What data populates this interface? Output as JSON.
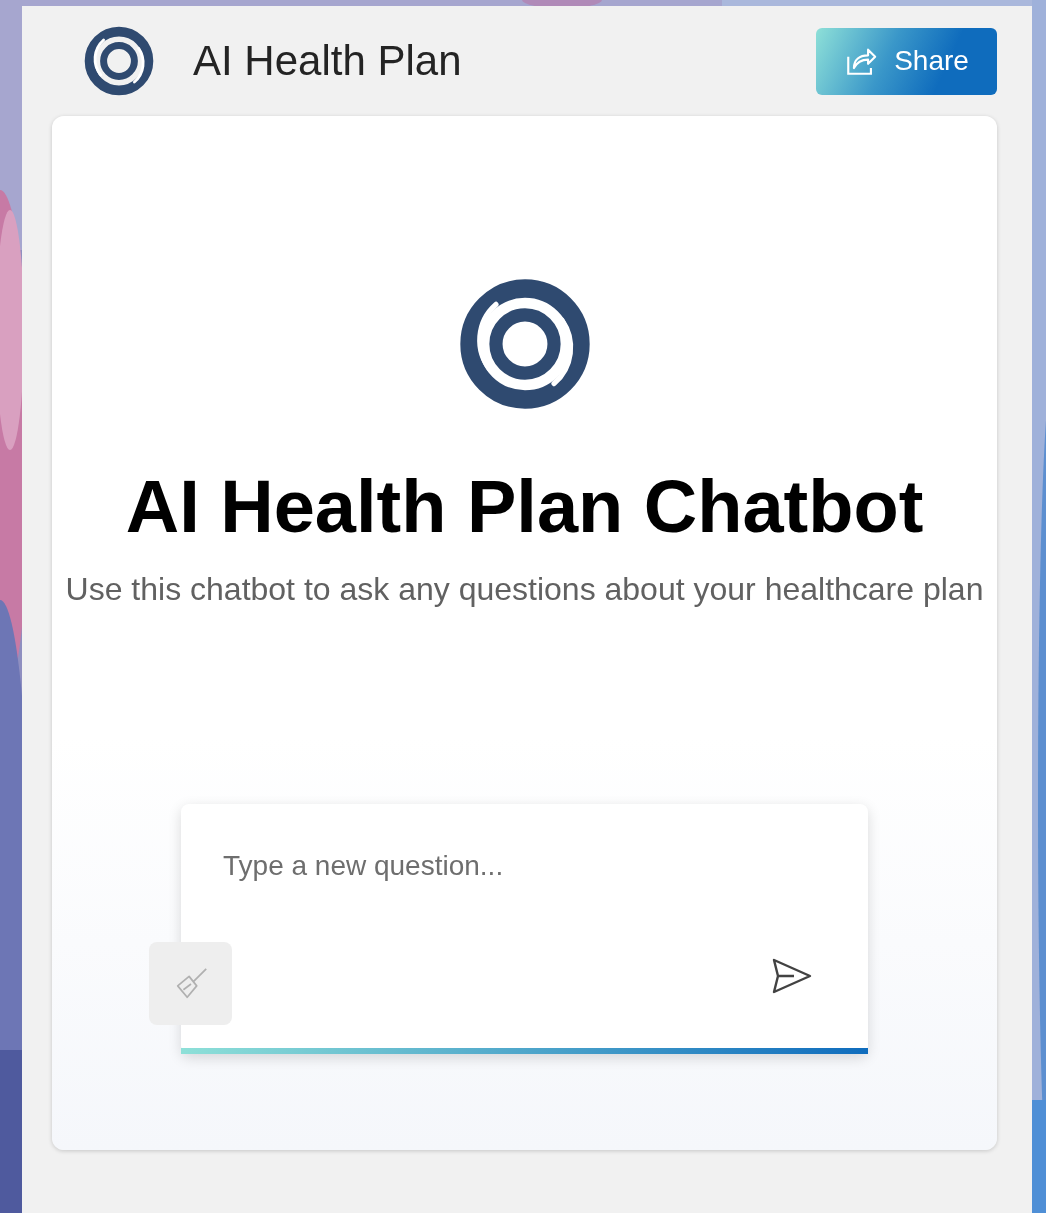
{
  "header": {
    "title": "AI Health Plan",
    "share_button": {
      "label": "Share"
    }
  },
  "chat": {
    "title": "AI Health Plan Chatbot",
    "subtitle": "Use this chatbot to ask any questions about your healthcare plan",
    "input": {
      "placeholder": "Type a new question..."
    },
    "clear_button": {
      "disabled": true
    },
    "send_button": {
      "disabled": false
    }
  }
}
